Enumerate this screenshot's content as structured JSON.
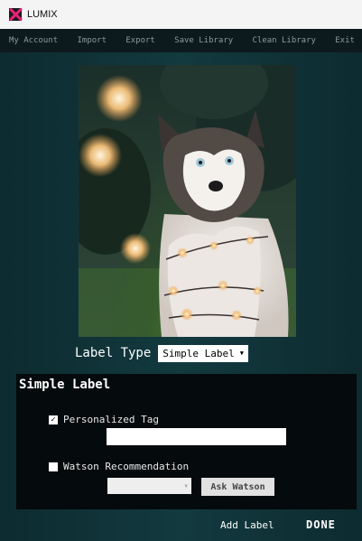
{
  "window": {
    "title": "LUMIX"
  },
  "menu": [
    "My Account",
    "Import",
    "Export",
    "Save Library",
    "Clean Library",
    "Exit"
  ],
  "label_type": {
    "label": "Label Type",
    "selected": "Simple Label"
  },
  "panel": {
    "title": "Simple Label",
    "personalized_tag": {
      "label": "Personalized Tag",
      "checked": true,
      "value": ""
    },
    "watson": {
      "label": "Watson Recommendation",
      "checked": false,
      "select_value": "",
      "button": "Ask Watson"
    }
  },
  "footer": {
    "add_label": "Add Label",
    "done": "DONE"
  },
  "colors": {
    "background": "#0d2b30",
    "menubar": "#0d1a1d",
    "panel": "#050a0c",
    "logo_accent": "#e8217a"
  }
}
